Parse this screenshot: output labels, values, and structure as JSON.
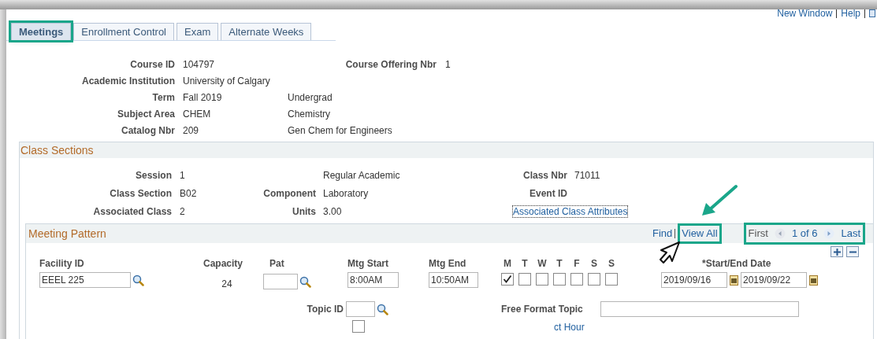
{
  "top_links": [
    {
      "label": "New Window"
    },
    {
      "label": "Help"
    }
  ],
  "tabs": [
    {
      "label": "Meetings",
      "selected": true,
      "highlighted": true
    },
    {
      "label": "Enrollment Control",
      "selected": false,
      "highlighted": false
    },
    {
      "label": "Exam",
      "selected": false,
      "highlighted": false
    },
    {
      "label": "Alternate Weeks",
      "selected": false,
      "highlighted": false
    }
  ],
  "course": {
    "course_id_label": "Course ID",
    "course_id": "104797",
    "offering_label": "Course Offering Nbr",
    "offering": "1",
    "rows": [
      {
        "label": "Academic Institution",
        "value": "University of Calgary"
      },
      {
        "label": "Term",
        "value": "Fall 2019",
        "description": "Undergrad"
      },
      {
        "label": "Subject Area",
        "value": "CHEM",
        "description": "Chemistry"
      },
      {
        "label": "Catalog Nbr",
        "value": "209",
        "description": "Gen Chem for Engineers"
      }
    ]
  },
  "class_sections": {
    "title": "Class Sections",
    "rows": [
      {
        "label": "Session",
        "value": "1",
        "label_2": "",
        "value_2": "Regular Academic",
        "label_3": "Class Nbr",
        "value_3": "71011"
      },
      {
        "label": "Class Section",
        "value": "B02",
        "label_2": "Component",
        "value_2": "Laboratory",
        "label_3": "Event ID",
        "value_3": ""
      },
      {
        "label": "Associated Class",
        "value": "2",
        "label_2": "Units",
        "value_2": "3.00",
        "link": "Associated Class Attributes"
      }
    ]
  },
  "meeting_pattern": {
    "title": "Meeting Pattern",
    "find": "Find",
    "view_all": "View All",
    "view_all_highlighted": true,
    "first": "First",
    "counter": "1 of 6",
    "last": "Last",
    "pager_highlighted": true,
    "columns": {
      "facility": "Facility ID",
      "capacity": "Capacity",
      "pat": "Pat",
      "mtg_start": "Mtg Start",
      "mtg_end": "Mtg End",
      "dates": "*Start/End Date"
    },
    "facility": "EEEL 225",
    "capacity": "24",
    "mtg_start": "8:00AM",
    "mtg_end": "10:50AM",
    "days": [
      {
        "label": "M",
        "checked": true
      },
      {
        "label": "T",
        "checked": false
      },
      {
        "label": "W",
        "checked": false
      },
      {
        "label": "T",
        "checked": false
      },
      {
        "label": "F",
        "checked": false
      },
      {
        "label": "S",
        "checked": false
      },
      {
        "label": "S",
        "checked": false
      }
    ],
    "start_date": "2019/09/16",
    "end_date": "2019/09/22",
    "topic_label": "Topic ID",
    "free_format_label": "Free Format Topic",
    "transcript_checked": false,
    "cut_link": "ct Hour"
  }
}
